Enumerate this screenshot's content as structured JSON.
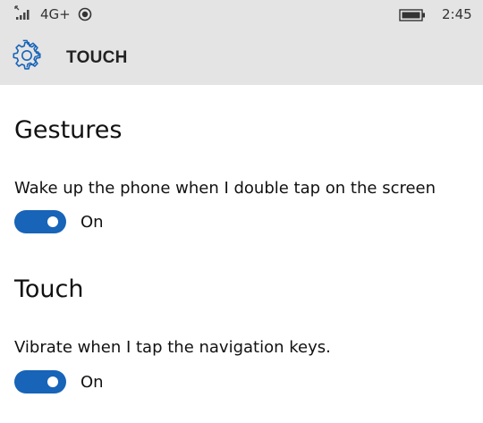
{
  "status_bar": {
    "network": "4G+",
    "time": "2:45",
    "icons": [
      "signal-icon",
      "location-icon",
      "battery-icon"
    ]
  },
  "header": {
    "title": "TOUCH",
    "icon": "gear-icon"
  },
  "sections": [
    {
      "heading": "Gestures",
      "setting": {
        "label": "Wake up the phone when I double tap on the screen",
        "state": "On",
        "enabled": true
      }
    },
    {
      "heading": "Touch",
      "setting": {
        "label": "Vibrate when I tap the navigation keys.",
        "state": "On",
        "enabled": true
      }
    }
  ],
  "colors": {
    "accent": "#1764b8",
    "header_background": "#e4e4e4",
    "background": "#ffffff"
  }
}
